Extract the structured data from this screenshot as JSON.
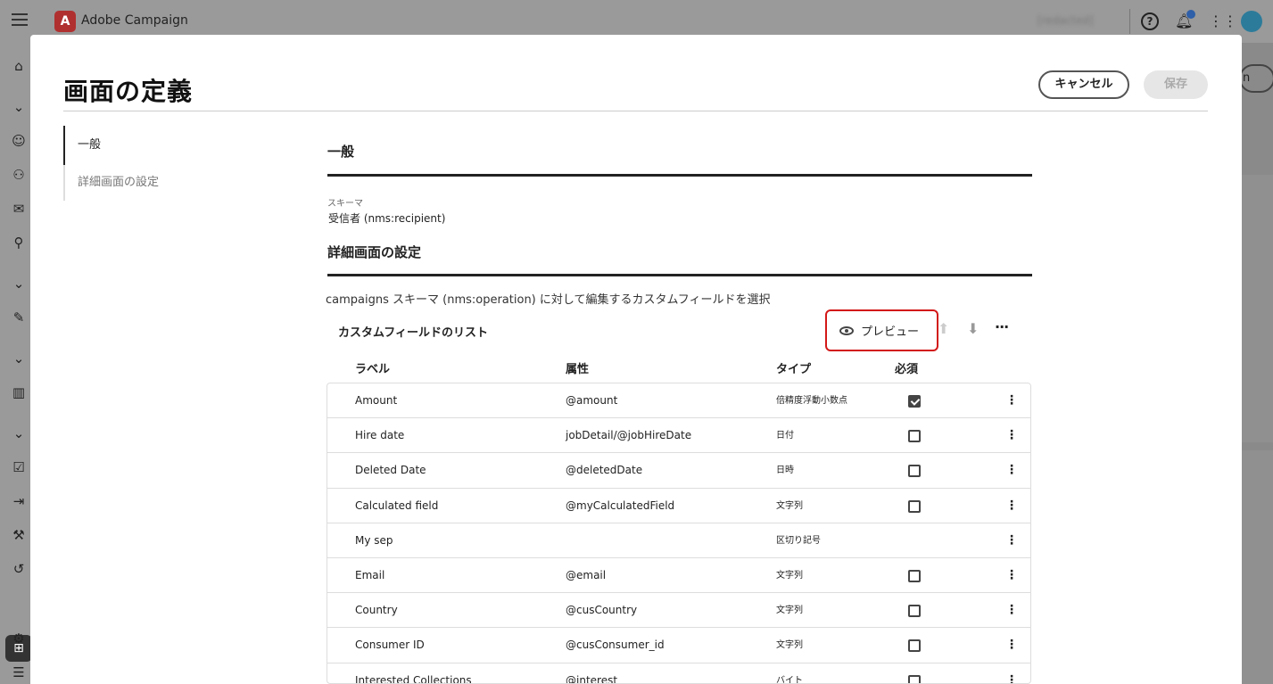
{
  "app": {
    "name": "Adobe Campaign",
    "logo_letter": "A",
    "user": "[redacted]"
  },
  "background": {
    "right_button_fragment": "n"
  },
  "modal": {
    "title": "画面の定義",
    "cancel_label": "キャンセル",
    "save_label": "保存",
    "nav": [
      {
        "label": "一般",
        "active": true
      },
      {
        "label": "詳細画面の設定",
        "active": false
      }
    ],
    "general": {
      "heading": "一般",
      "schema_label": "スキーマ",
      "schema_value": "受信者 (nms:recipient)"
    },
    "detail": {
      "heading": "詳細画面の設定",
      "description": "campaigns スキーマ (nms:operation) に対して編集するカスタムフィールドを選択",
      "list_title": "カスタムフィールドのリスト",
      "preview_label": "プレビュー",
      "columns": {
        "label": "ラベル",
        "attribute": "属性",
        "type": "タイプ",
        "required": "必須"
      },
      "rows": [
        {
          "label": "Amount",
          "attribute": "@amount",
          "type": "倍精度浮動小数点",
          "required": true,
          "has_checkbox": true
        },
        {
          "label": "Hire date",
          "attribute": "jobDetail/@jobHireDate",
          "type": "日付",
          "required": false,
          "has_checkbox": true
        },
        {
          "label": "Deleted Date",
          "attribute": "@deletedDate",
          "type": "日時",
          "required": false,
          "has_checkbox": true
        },
        {
          "label": "Calculated field",
          "attribute": "@myCalculatedField",
          "type": "文字列",
          "required": false,
          "has_checkbox": true
        },
        {
          "label": "My sep",
          "attribute": "",
          "type": "区切り記号",
          "required": false,
          "has_checkbox": false
        },
        {
          "label": "Email",
          "attribute": "@email",
          "type": "文字列",
          "required": false,
          "has_checkbox": true
        },
        {
          "label": "Country",
          "attribute": "@cusCountry",
          "type": "文字列",
          "required": false,
          "has_checkbox": true
        },
        {
          "label": "Consumer ID",
          "attribute": "@cusConsumer_id",
          "type": "文字列",
          "required": false,
          "has_checkbox": true
        },
        {
          "label": "Interested Collections",
          "attribute": "@interest",
          "type": "バイト",
          "required": false,
          "has_checkbox": true
        }
      ]
    }
  },
  "colors": {
    "highlight": "#d31818",
    "brand": "#b03030"
  }
}
